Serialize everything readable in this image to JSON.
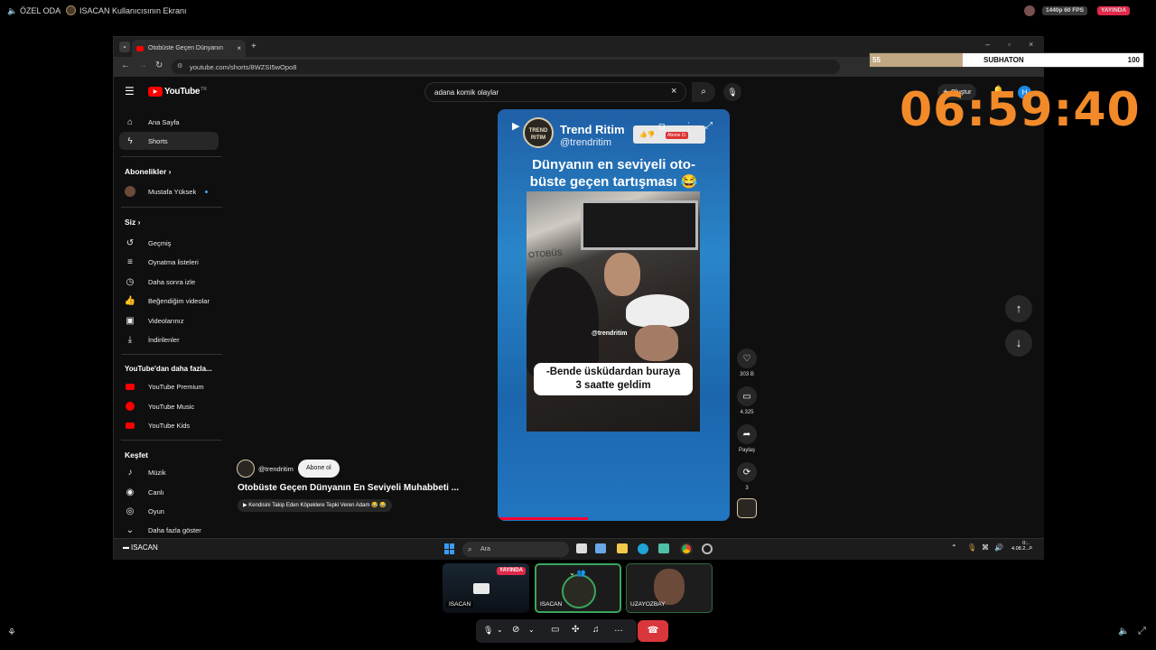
{
  "discord": {
    "room_label": "ÖZEL ODA",
    "screen_title": "ISACAN Kullanıcısının Ekranı",
    "quality": "1440p 60 FPS",
    "live_badge": "YAYINDA"
  },
  "browser": {
    "tab_title": "Otobüste Geçen Dünyanın",
    "url": "youtube.com/shorts/8WZSI5wOpo8"
  },
  "youtube": {
    "logo": "YouTube",
    "region": "TR",
    "search_query": "adana komik olaylar",
    "create_label": "Oluştur",
    "avatar_letter": "H",
    "sidebar": {
      "home": "Ana Sayfa",
      "shorts": "Shorts",
      "subs_header": "Abonelikler",
      "sub_channel": "Mustafa Yüksek",
      "you_header": "Siz",
      "history": "Geçmiş",
      "playlists": "Oynatma listeleri",
      "watch_later": "Daha sonra izle",
      "liked": "Beğendiğim videolar",
      "your_videos": "Videolarınız",
      "downloads": "İndirilenler",
      "more_header": "YouTube'dan daha fazla...",
      "premium": "YouTube Premium",
      "music": "YouTube Music",
      "kids": "YouTube Kids",
      "explore_header": "Keşfet",
      "music_cat": "Müzik",
      "live": "Canlı",
      "gaming": "Oyun",
      "show_more": "Daha fazla göster"
    },
    "short": {
      "channel_name": "Trend Ritim",
      "channel_handle": "@trendritim",
      "channel_logo": "TREND RITIM",
      "headline_1": "Dünyanın en seviyeli oto-",
      "headline_2": "büste geçen tartışması 😂",
      "watermark": "@trendritim",
      "caption_1": "-Bende üsküdardan buraya",
      "caption_2": "3 saatte geldim",
      "mini_sub": "Abone O.",
      "likes": "303 B",
      "comments": "4.325",
      "share": "Paylaş",
      "remix": "3",
      "bus_sign": "OTOBÜS"
    },
    "meta": {
      "handle": "@trendritim",
      "subscribe": "Abone ol",
      "title": "Otobüste Geçen Dünyanın En Seviyeli Muhabbeti ...",
      "related": "Kendisini Takip Eden Köpeklere Tepki Veren Adam 😂 😂"
    }
  },
  "taskbar": {
    "streamer": "ISACAN",
    "search_placeholder": "Ara",
    "clock_time": "0:..",
    "clock_date": "4.08.2..."
  },
  "subathon": {
    "current": "55",
    "label": "SUBHATON",
    "max": "100",
    "fill_fraction": 0.34,
    "timer": "06:59:40"
  },
  "participants": [
    {
      "name": "ISACAN",
      "badge": "YAYINDA"
    },
    {
      "name": "ISACAN"
    },
    {
      "name": "UZAYOZBAY"
    }
  ],
  "colors": {
    "timer": "#f28a2a",
    "live_red": "#e0294a",
    "yt_red": "#ff0000",
    "speaking_green": "#3ba55d",
    "end_call": "#da373c"
  }
}
